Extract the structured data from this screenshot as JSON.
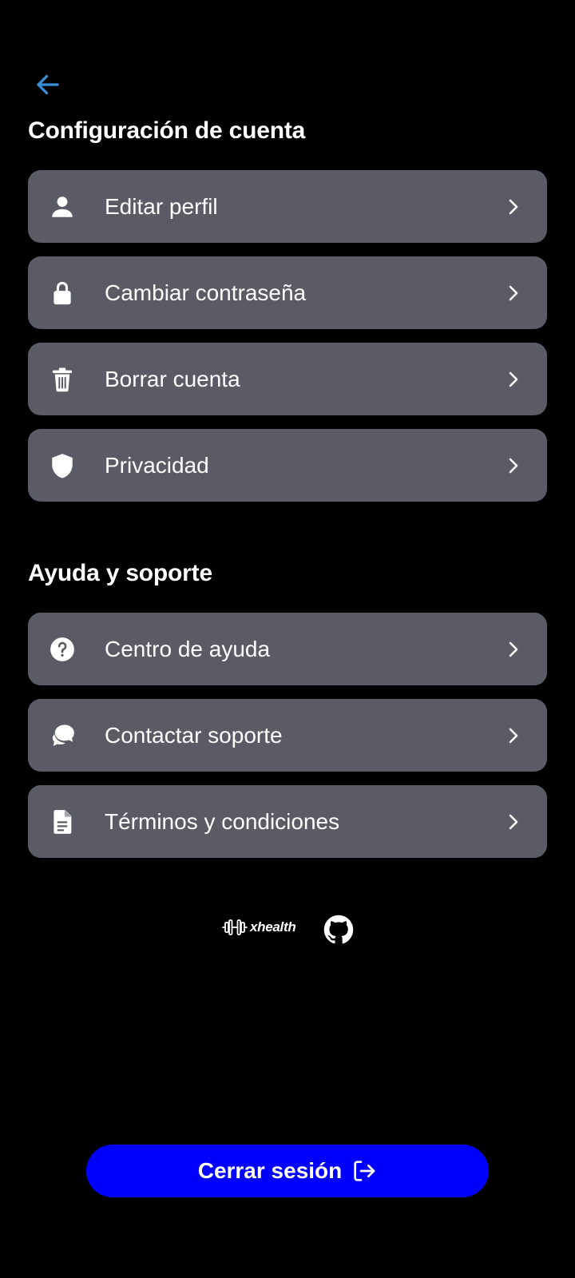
{
  "header": {
    "back_icon": "arrow-left-icon",
    "accent_color": "#3b8fd9"
  },
  "account_section": {
    "title": "Configuración de cuenta",
    "items": [
      {
        "label": "Editar perfil",
        "icon": "person-icon"
      },
      {
        "label": "Cambiar contraseña",
        "icon": "lock-icon"
      },
      {
        "label": "Borrar cuenta",
        "icon": "trash-icon"
      },
      {
        "label": "Privacidad",
        "icon": "shield-icon"
      }
    ]
  },
  "help_section": {
    "title": "Ayuda y soporte",
    "items": [
      {
        "label": "Centro de ayuda",
        "icon": "help-circle-icon"
      },
      {
        "label": "Contactar soporte",
        "icon": "chat-bubbles-icon"
      },
      {
        "label": "Términos y condiciones",
        "icon": "document-icon"
      }
    ]
  },
  "footer": {
    "brand": "xhealth",
    "github_icon": "github-icon"
  },
  "logout": {
    "label": "Cerrar sesión",
    "icon": "logout-icon",
    "color": "#0000ff"
  },
  "colors": {
    "background": "#000000",
    "card": "#5b5b66",
    "text": "#ffffff"
  }
}
